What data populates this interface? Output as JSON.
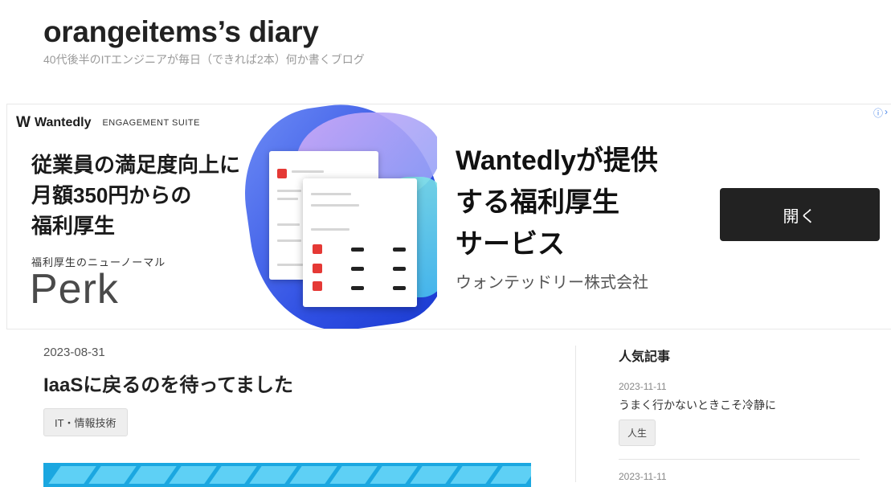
{
  "blog": {
    "title": "orangeitems’s diary",
    "description": "40代後半のITエンジニアが毎日（できれば2本）何か書くブログ"
  },
  "ad": {
    "logo_mark": "W",
    "logo_name": "Wantedly",
    "logo_suite": "ENGAGEMENT SUITE",
    "headline_lines": [
      "従業員の満足度向上に",
      "月額350円からの",
      "福利厚生"
    ],
    "subline": "福利厚生のニューノーマル",
    "product": "Perk",
    "right_title_lines": [
      "Wantedlyが提供",
      "する福利厚生",
      "サービス"
    ],
    "company": "ウォンテッドリー株式会社",
    "open_button": "開く",
    "info_icon": "info-icon",
    "accent": "#2f4fe3"
  },
  "post": {
    "date": "2023-08-31",
    "title": "IaaSに戻るのを待ってました",
    "category": "IT・情報技術"
  },
  "sidebar": {
    "title": "人気記事",
    "items": [
      {
        "date": "2023-11-11",
        "title": "うまく行かないときこそ冷静に",
        "tag": "人生"
      },
      {
        "date": "2023-11-11"
      }
    ]
  }
}
